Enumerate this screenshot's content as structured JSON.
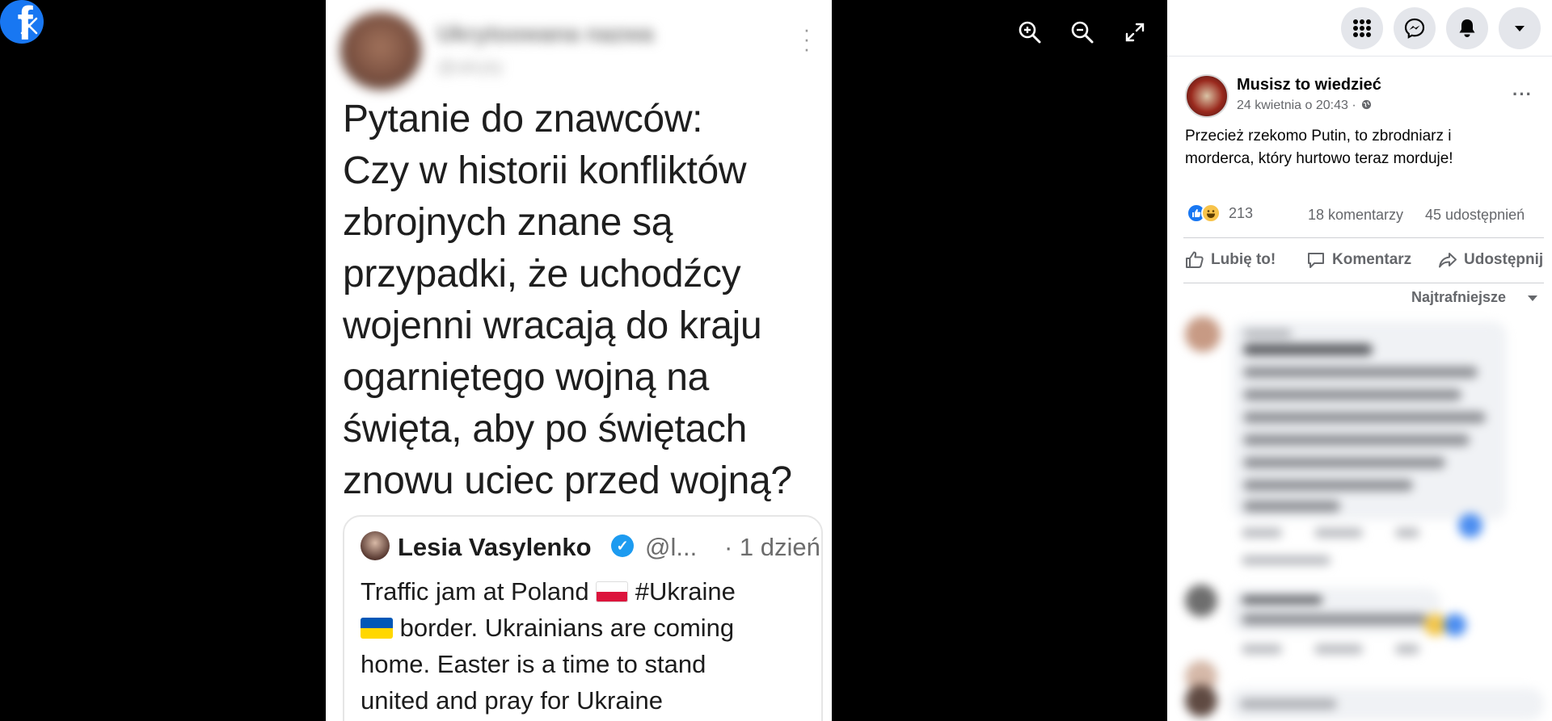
{
  "viewer": {
    "close_icon": "close-icon",
    "logo_icon": "facebook-logo-icon",
    "logo_letter": "f",
    "controls": [
      "zoom-in-icon",
      "zoom-out-icon",
      "fullscreen-icon"
    ]
  },
  "tweet": {
    "text_lines": [
      "Pytanie do znawców:",
      "Czy w historii konfliktów",
      "zbrojnych znane są",
      "przypadki, że uchodźcy",
      "wojenni wracają do kraju",
      "ogarniętego wojną na",
      "święta, aby po świętach",
      "znowu uciec przed wojną?"
    ],
    "quote": {
      "name": "Lesia Vasylenko",
      "handle": "@l...",
      "time": "· 1 dzień",
      "line1": "Traffic jam at Poland ",
      "line1b": " #Ukraine",
      "line2": " border. Ukrainians are coming",
      "line3": "home. Easter is a time to stand",
      "line4": "united and pray for Ukraine"
    }
  },
  "header": {
    "buttons": [
      "menu-grid-icon",
      "messenger-icon",
      "notifications-bell-icon",
      "account-dropdown-icon"
    ]
  },
  "post": {
    "author": "Musisz to wiedzieć",
    "date": "24 kwietnia o 20:43 ·",
    "privacy_icon": "globe-icon",
    "text": "Przecież rzekomo Putin, to zbrodniarz i morderca, który hurtowo teraz morduje!",
    "reactions_count": "213",
    "comments_count": "18 komentarzy",
    "shares_count": "45 udostępnień",
    "actions": {
      "like": "Lubię to!",
      "comment": "Komentarz",
      "share": "Udostępnij"
    },
    "sort_label": "Najtrafniejsze"
  },
  "colors": {
    "facebook_blue": "#1877f2",
    "twitter_blue": "#1d9bf0",
    "secondary_text": "#65676b"
  }
}
